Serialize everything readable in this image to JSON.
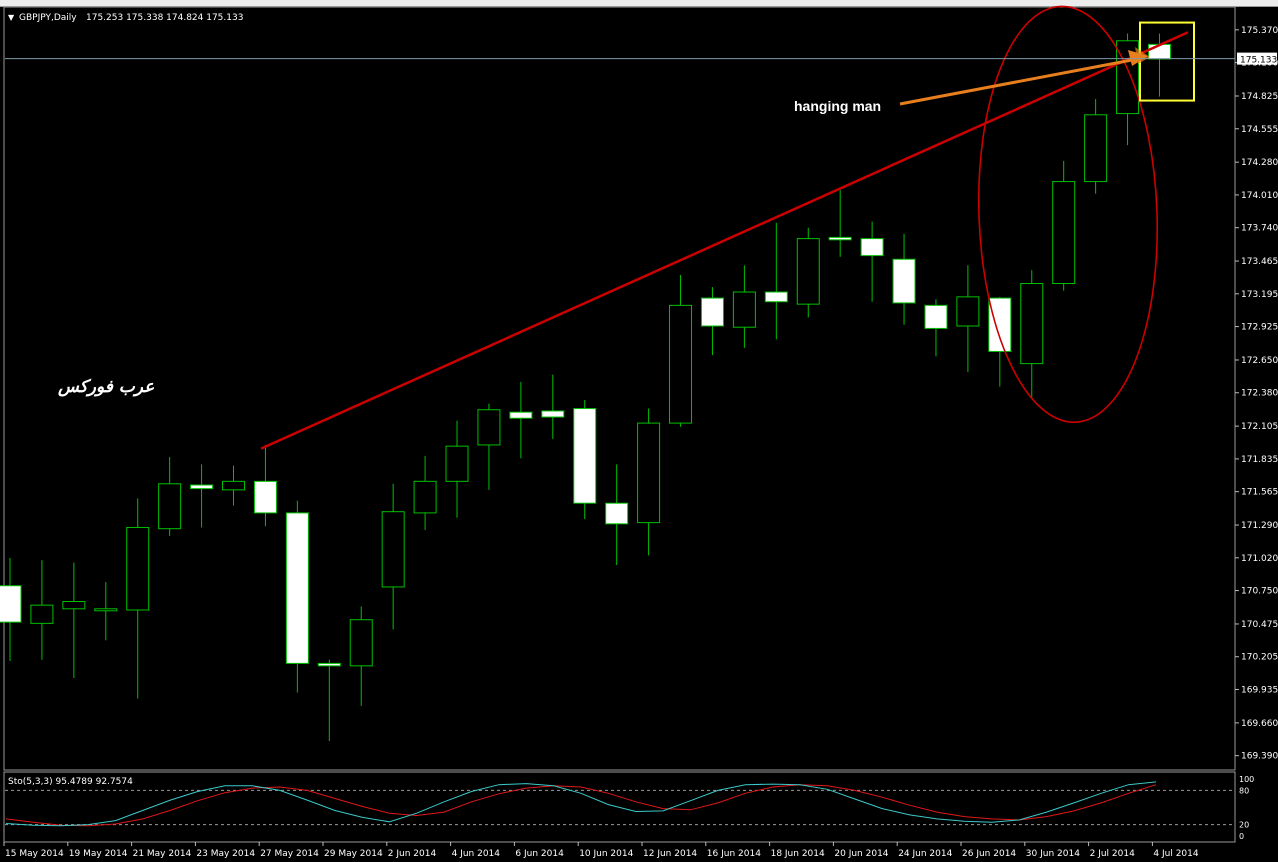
{
  "header": {
    "symbol_label": "GBPJPY,Daily",
    "ohlc_label": "175.253 175.338 174.824 175.133",
    "menu_glyph": "▼"
  },
  "annotations": {
    "hanging_man": "hanging man",
    "watermark": "عرب فوركس"
  },
  "colors": {
    "background": "#000000",
    "bull_outline": "#00c000",
    "bear_fill": "#ffffff",
    "wick": "#00c000",
    "trendline": "#cc0000",
    "ellipse": "#cc0000",
    "arrow": "#e87f1e",
    "highlight_box": "#ffff33",
    "price_line": "#7f9aa8",
    "stoch_main": "#3cc9c9",
    "stoch_signal": "#e01818",
    "axis_text": "#ffffff"
  },
  "chart_data": {
    "type": "candlestick",
    "title": "GBPJPY,Daily",
    "ylim": [
      169.28,
      175.55
    ],
    "y_ticks": [
      "175.370",
      "175.100",
      "174.825",
      "174.555",
      "174.280",
      "174.010",
      "173.740",
      "173.465",
      "173.195",
      "172.925",
      "172.650",
      "172.380",
      "172.105",
      "171.835",
      "171.565",
      "171.290",
      "171.020",
      "170.750",
      "170.475",
      "170.205",
      "169.935",
      "169.660",
      "169.390"
    ],
    "current_price": "175.133",
    "x_labels": [
      "15 May 2014",
      "19 May 2014",
      "21 May 2014",
      "23 May 2014",
      "27 May 2014",
      "29 May 2014",
      "2 Jun 2014",
      "4 Jun 2014",
      "6 Jun 2014",
      "10 Jun 2014",
      "12 Jun 2014",
      "16 Jun 2014",
      "18 Jun 2014",
      "20 Jun 2014",
      "24 Jun 2014",
      "26 Jun 2014",
      "30 Jun 2014",
      "2 Jul 2014",
      "4 Jul 2014"
    ],
    "candles": [
      {
        "o": 170.79,
        "h": 171.02,
        "l": 170.17,
        "c": 170.49
      },
      {
        "o": 170.48,
        "h": 171.0,
        "l": 170.18,
        "c": 170.63
      },
      {
        "o": 170.6,
        "h": 170.98,
        "l": 170.03,
        "c": 170.66
      },
      {
        "o": 170.6,
        "h": 170.82,
        "l": 170.34,
        "c": 170.6
      },
      {
        "o": 170.59,
        "h": 171.51,
        "l": 169.86,
        "c": 171.27
      },
      {
        "o": 171.26,
        "h": 171.85,
        "l": 171.2,
        "c": 171.63
      },
      {
        "o": 171.62,
        "h": 171.79,
        "l": 171.27,
        "c": 171.59
      },
      {
        "o": 171.58,
        "h": 171.78,
        "l": 171.45,
        "c": 171.65
      },
      {
        "o": 171.65,
        "h": 171.95,
        "l": 171.28,
        "c": 171.39
      },
      {
        "o": 171.39,
        "h": 171.49,
        "l": 169.91,
        "c": 170.15
      },
      {
        "o": 170.15,
        "h": 170.18,
        "l": 169.51,
        "c": 170.13
      },
      {
        "o": 170.13,
        "h": 170.62,
        "l": 169.8,
        "c": 170.51
      },
      {
        "o": 170.78,
        "h": 171.63,
        "l": 170.43,
        "c": 171.4
      },
      {
        "o": 171.39,
        "h": 171.86,
        "l": 171.25,
        "c": 171.65
      },
      {
        "o": 171.65,
        "h": 172.15,
        "l": 171.35,
        "c": 171.94
      },
      {
        "o": 171.95,
        "h": 172.29,
        "l": 171.58,
        "c": 172.24
      },
      {
        "o": 172.22,
        "h": 172.47,
        "l": 171.84,
        "c": 172.17
      },
      {
        "o": 172.23,
        "h": 172.53,
        "l": 172.0,
        "c": 172.18
      },
      {
        "o": 172.25,
        "h": 172.32,
        "l": 171.34,
        "c": 171.47
      },
      {
        "o": 171.47,
        "h": 171.79,
        "l": 170.96,
        "c": 171.3
      },
      {
        "o": 171.31,
        "h": 172.25,
        "l": 171.04,
        "c": 172.13
      },
      {
        "o": 172.13,
        "h": 173.35,
        "l": 172.1,
        "c": 173.1
      },
      {
        "o": 173.16,
        "h": 173.25,
        "l": 172.69,
        "c": 172.93
      },
      {
        "o": 172.92,
        "h": 173.43,
        "l": 172.75,
        "c": 173.21
      },
      {
        "o": 173.21,
        "h": 173.78,
        "l": 172.82,
        "c": 173.13
      },
      {
        "o": 173.11,
        "h": 173.74,
        "l": 173.0,
        "c": 173.65
      },
      {
        "o": 173.66,
        "h": 174.05,
        "l": 173.5,
        "c": 173.64
      },
      {
        "o": 173.65,
        "h": 173.79,
        "l": 173.13,
        "c": 173.51
      },
      {
        "o": 173.48,
        "h": 173.69,
        "l": 172.94,
        "c": 173.12
      },
      {
        "o": 173.1,
        "h": 173.15,
        "l": 172.68,
        "c": 172.91
      },
      {
        "o": 172.93,
        "h": 173.43,
        "l": 172.55,
        "c": 173.17
      },
      {
        "o": 173.16,
        "h": 173.17,
        "l": 172.43,
        "c": 172.72
      },
      {
        "o": 172.62,
        "h": 173.39,
        "l": 172.34,
        "c": 173.28
      },
      {
        "o": 173.28,
        "h": 174.29,
        "l": 173.22,
        "c": 174.12
      },
      {
        "o": 174.12,
        "h": 174.8,
        "l": 174.02,
        "c": 174.67
      },
      {
        "o": 174.68,
        "h": 175.34,
        "l": 174.42,
        "c": 175.28
      },
      {
        "o": 175.25,
        "h": 175.34,
        "l": 174.82,
        "c": 175.13
      }
    ],
    "stochastic": {
      "label": "Sto(5,3,3) 95.4789 92.7574",
      "levels": [
        "100",
        "80",
        "20",
        "0"
      ],
      "ylim": [
        0,
        100
      ],
      "main": [
        22,
        19,
        18,
        20,
        27,
        45,
        63,
        78,
        88,
        88,
        80,
        63,
        45,
        33,
        25,
        40,
        60,
        78,
        90,
        92,
        88,
        75,
        55,
        43,
        44,
        62,
        80,
        90,
        91,
        90,
        82,
        65,
        48,
        37,
        30,
        26,
        24,
        28,
        42,
        58,
        75,
        90,
        95
      ],
      "signal": [
        30,
        24,
        19,
        18,
        21,
        30,
        45,
        62,
        76,
        84,
        86,
        80,
        66,
        52,
        40,
        36,
        42,
        60,
        74,
        84,
        88,
        86,
        75,
        60,
        48,
        46,
        58,
        75,
        86,
        90,
        88,
        80,
        68,
        54,
        42,
        34,
        30,
        28,
        34,
        44,
        58,
        75,
        90
      ]
    }
  }
}
